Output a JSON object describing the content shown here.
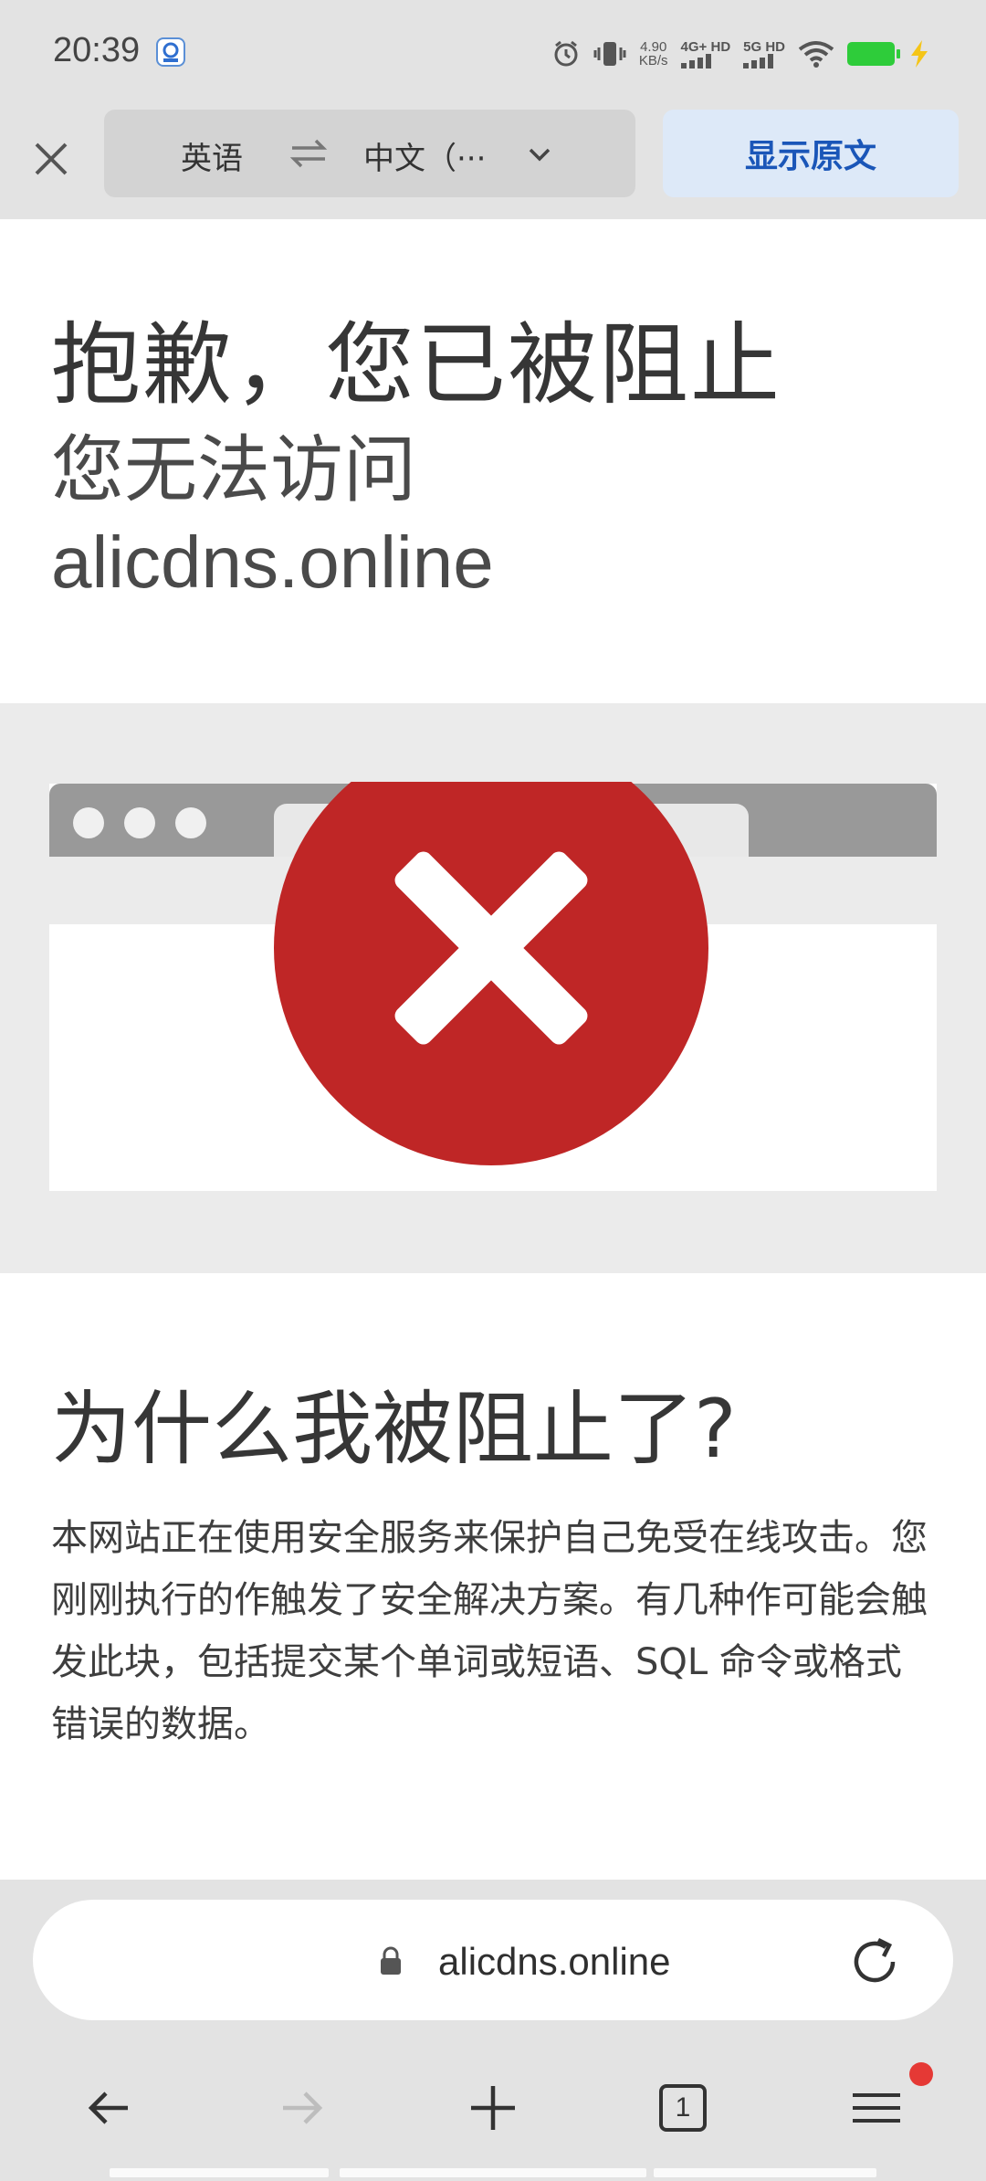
{
  "status_bar": {
    "time": "20:39",
    "net_speed_value": "4.90",
    "net_speed_unit": "KB/s",
    "sim1_label": "4G+ HD",
    "sim2_label": "5G HD",
    "icons": [
      "alarm-icon",
      "vibrate-icon",
      "wifi-icon",
      "battery-icon",
      "charging-icon"
    ]
  },
  "translate_bar": {
    "source_language": "英语",
    "target_language": "中文（···",
    "show_original_label": "显示原文"
  },
  "page": {
    "headline": "抱歉，您已被阻止",
    "subheadline_line1": "您无法访问",
    "subheadline_line2": "alicdns.online",
    "why_title": "为什么我被阻止了?",
    "why_body": "本网站正在使用安全服务来保护自己免受在线攻击。您刚刚执行的作触发了安全解决方案。有几种作可能会触发此块，包括提交某个单词或短语、SQL 命令或格式错误的数据。"
  },
  "address_bar": {
    "url": "alicdns.online"
  },
  "bottom_nav": {
    "tab_count": "1"
  },
  "colors": {
    "block_red": "#bf2626",
    "accent_blue": "#1a56b8",
    "battery_green": "#2ecc3a"
  }
}
